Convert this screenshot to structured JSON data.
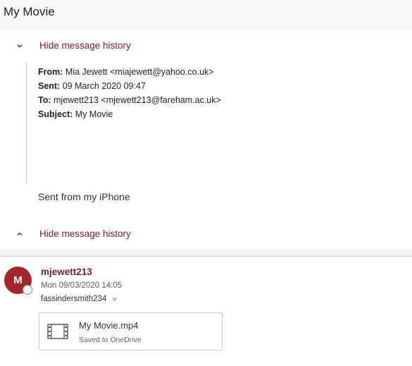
{
  "email": {
    "title": "My Movie",
    "history": {
      "hide_top_label": "Hide message history",
      "hide_bottom_label": "Hide message history"
    },
    "quoted": {
      "from_label": "From:",
      "from_value": "Mia Jewett <miajewett@yahoo.co.uk>",
      "sent_label": "Sent:",
      "sent_value": "09 March 2020 09:47",
      "to_label": "To:",
      "to_value": "mjewett213 <mjewett213@fareham.ac.uk>",
      "subject_label": "Subject:",
      "subject_value": "My Movie",
      "signature": "Sent from my iPhone"
    },
    "reply": {
      "avatar_initial": "M",
      "avatar_color": "#a4262c",
      "sender": "mjewett213",
      "date": "Mon 09/03/2020 14:05",
      "recipient": "fassindersmith234",
      "attachment": {
        "name": "My Movie.mp4",
        "status": "Saved to OneDrive",
        "icon": "video-file-icon"
      }
    },
    "accent_color": "#7a1d22"
  }
}
